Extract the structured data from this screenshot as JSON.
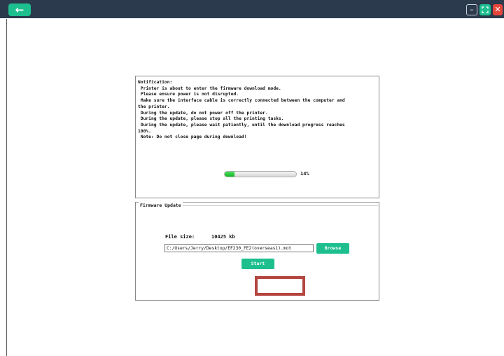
{
  "titlebar": {
    "back_glyph": "←",
    "back_icon": "arrow-left-icon",
    "minimize_glyph": "–",
    "maximize_glyph": "⛶",
    "close_glyph": "✕",
    "accent_color": "#1dbf8f",
    "close_color": "#e5463b",
    "bar_color": "#2b3a4d"
  },
  "notification": {
    "text": "Notification:\n Printer is about to enter the firmware download mode.\n Please ensure power is not disrupted.\n Make sure the interface cable is correctly connected between the computer and\nthe printer.\n During the update, do not power off the printer.\n During the update, please stop all the printing tasks.\n During the update, please wait patiently, until the download progress reaches\n100%.\n Note: Do not close page during download!",
    "progress_value": 0.14,
    "progress_text": "14%"
  },
  "firmware_update": {
    "legend": "Firmware Update",
    "file_size_label": "File size:",
    "file_size_value": "10425 kb",
    "file_path": "C:/Users/Jerry/Desktop/EF230_FE2(overseas1).mot",
    "browse_label": "Browse",
    "start_label": "Start"
  }
}
